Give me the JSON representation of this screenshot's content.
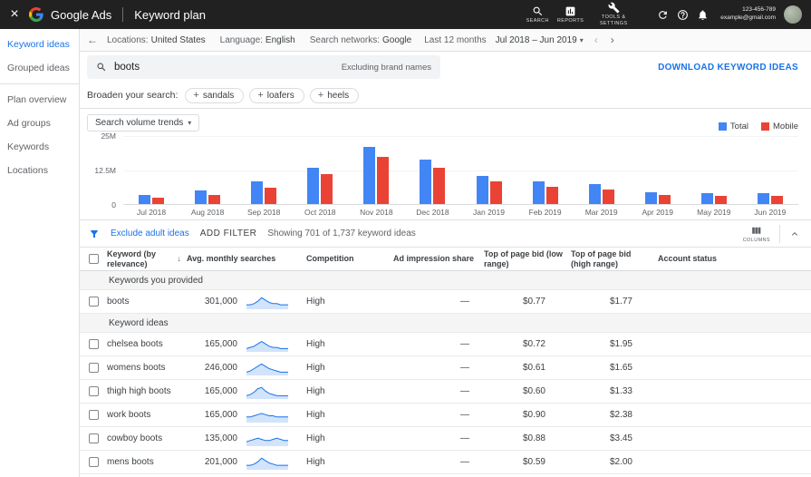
{
  "icons": {
    "close": "×",
    "back": "←",
    "caret_down": "▾",
    "prev": "‹",
    "next": "›",
    "sort_desc": "↓",
    "plus": "+"
  },
  "topbar": {
    "brand": "Google Ads",
    "page_title": "Keyword plan",
    "nav": [
      {
        "label": "SEARCH"
      },
      {
        "label": "REPORTS"
      },
      {
        "label": "TOOLS & SETTINGS"
      }
    ],
    "account_id": "123-456-789",
    "account_email": "example@gmail.com"
  },
  "sidebar": {
    "items": [
      {
        "label": "Keyword ideas",
        "active": true,
        "divider_after": false
      },
      {
        "label": "Grouped ideas",
        "active": false,
        "divider_after": true
      },
      {
        "label": "Plan overview",
        "active": false,
        "divider_after": false
      },
      {
        "label": "Ad groups",
        "active": false,
        "divider_after": false
      },
      {
        "label": "Keywords",
        "active": false,
        "divider_after": false
      },
      {
        "label": "Locations",
        "active": false,
        "divider_after": false
      }
    ]
  },
  "settings_bar": {
    "items": [
      {
        "label": "Locations:",
        "value": "United States"
      },
      {
        "label": "Language:",
        "value": "English"
      },
      {
        "label": "Search networks:",
        "value": "Google"
      }
    ],
    "date_range_label": "Last 12 months",
    "date_range_value": "Jul 2018 – Jun 2019"
  },
  "search": {
    "query": "boots",
    "note": "Excluding brand names",
    "download_label": "DOWNLOAD KEYWORD IDEAS"
  },
  "broaden": {
    "label": "Broaden your search:",
    "chips": [
      "sandals",
      "loafers",
      "heels"
    ]
  },
  "chart_data": {
    "type": "bar",
    "title": "Search volume trends",
    "categories": [
      "Jul 2018",
      "Aug 2018",
      "Sep 2018",
      "Oct 2018",
      "Nov 2018",
      "Dec 2018",
      "Jan 2019",
      "Feb 2019",
      "Mar 2019",
      "Apr 2019",
      "May 2019",
      "Jun 2019"
    ],
    "series": [
      {
        "name": "Total",
        "color": "#4285f4",
        "values": [
          3.5,
          5,
          8.5,
          13.5,
          21,
          16.5,
          10.5,
          8.5,
          7.5,
          4.5,
          4,
          4
        ]
      },
      {
        "name": "Mobile",
        "color": "#ea4335",
        "values": [
          2.5,
          3.5,
          6,
          11,
          17.5,
          13.5,
          8.5,
          6.5,
          5.5,
          3.5,
          3,
          3
        ]
      }
    ],
    "unit": "M searches",
    "ylim": [
      0,
      25
    ],
    "yticks": [
      "0",
      "12.5M",
      "25M"
    ],
    "grid": true,
    "legend_position": "top-right"
  },
  "filter_bar": {
    "exclude_label": "Exclude adult ideas",
    "add_filter_label": "ADD FILTER",
    "showing": "Showing 701 of 1,737 keyword ideas",
    "columns_label": "COLUMNS"
  },
  "table": {
    "headers": [
      "",
      "Keyword (by relevance)",
      "Avg. monthly searches",
      "Competition",
      "Ad impression share",
      "Top of page bid (low range)",
      "Top of page bid (high range)",
      "Account status"
    ],
    "sections": [
      {
        "title": "Keywords you provided",
        "rows": [
          {
            "keyword": "boots",
            "avg_monthly_searches": "301,000",
            "trend": [
              3,
              3,
              4,
              6,
              9,
              7,
              5,
              4,
              4,
              3,
              3,
              3
            ],
            "competition": "High",
            "ad_impression_share": "—",
            "top_bid_low": "$0.77",
            "top_bid_high": "$1.77",
            "account_status": ""
          }
        ]
      },
      {
        "title": "Keyword ideas",
        "rows": [
          {
            "keyword": "chelsea boots",
            "avg_monthly_searches": "165,000",
            "trend": [
              2,
              3,
              4,
              6,
              8,
              6,
              4,
              3,
              3,
              2,
              2,
              2
            ],
            "competition": "High",
            "ad_impression_share": "—",
            "top_bid_low": "$0.72",
            "top_bid_high": "$1.95",
            "account_status": ""
          },
          {
            "keyword": "womens boots",
            "avg_monthly_searches": "246,000",
            "trend": [
              2,
              3,
              5,
              7,
              9,
              7,
              5,
              4,
              3,
              2,
              2,
              2
            ],
            "competition": "High",
            "ad_impression_share": "—",
            "top_bid_low": "$0.61",
            "top_bid_high": "$1.65",
            "account_status": ""
          },
          {
            "keyword": "thigh high boots",
            "avg_monthly_searches": "165,000",
            "trend": [
              2,
              3,
              5,
              8,
              9,
              6,
              4,
              3,
              2,
              2,
              2,
              2
            ],
            "competition": "High",
            "ad_impression_share": "—",
            "top_bid_low": "$0.60",
            "top_bid_high": "$1.33",
            "account_status": ""
          },
          {
            "keyword": "work boots",
            "avg_monthly_searches": "165,000",
            "trend": [
              4,
              4,
              5,
              6,
              7,
              6,
              5,
              5,
              4,
              4,
              4,
              4
            ],
            "competition": "High",
            "ad_impression_share": "—",
            "top_bid_low": "$0.90",
            "top_bid_high": "$2.38",
            "account_status": ""
          },
          {
            "keyword": "cowboy boots",
            "avg_monthly_searches": "135,000",
            "trend": [
              3,
              4,
              5,
              6,
              5,
              4,
              4,
              5,
              6,
              5,
              4,
              4
            ],
            "competition": "High",
            "ad_impression_share": "—",
            "top_bid_low": "$0.88",
            "top_bid_high": "$3.45",
            "account_status": ""
          },
          {
            "keyword": "mens boots",
            "avg_monthly_searches": "201,000",
            "trend": [
              3,
              3,
              4,
              6,
              9,
              7,
              5,
              4,
              3,
              3,
              3,
              3
            ],
            "competition": "High",
            "ad_impression_share": "—",
            "top_bid_low": "$0.59",
            "top_bid_high": "$2.00",
            "account_status": ""
          }
        ]
      }
    ]
  }
}
